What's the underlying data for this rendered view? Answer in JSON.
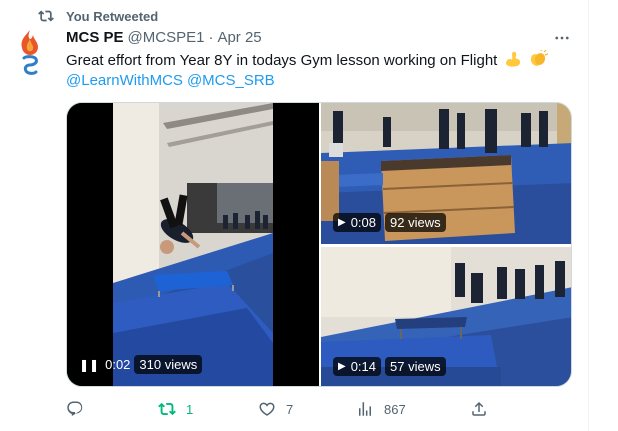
{
  "retweet_context": {
    "label": "You Retweeted"
  },
  "tweet": {
    "author_name": "MCS PE",
    "handle": "@MCSPE1",
    "separator": "·",
    "date": "Apr 25",
    "text": "Great effort from Year 8Y in todays Gym lesson working on Flight",
    "mentions": [
      "@LearnWithMCS",
      "@MCS_SRB"
    ],
    "emojis": [
      "flexed-biceps",
      "clapping-hands"
    ]
  },
  "media": [
    {
      "time": "0:02",
      "views": "310 views",
      "state": "playing"
    },
    {
      "time": "0:08",
      "views": "92 views",
      "state": "paused"
    },
    {
      "time": "0:14",
      "views": "57 views",
      "state": "paused"
    }
  ],
  "actions": {
    "replies": "",
    "retweets": "1",
    "likes": "7",
    "views": "867"
  },
  "colors": {
    "accent": "#1d9bf0",
    "retweet_active": "#00ba7c",
    "secondary_text": "#536471",
    "mat_blue": "#2a4f9c"
  }
}
